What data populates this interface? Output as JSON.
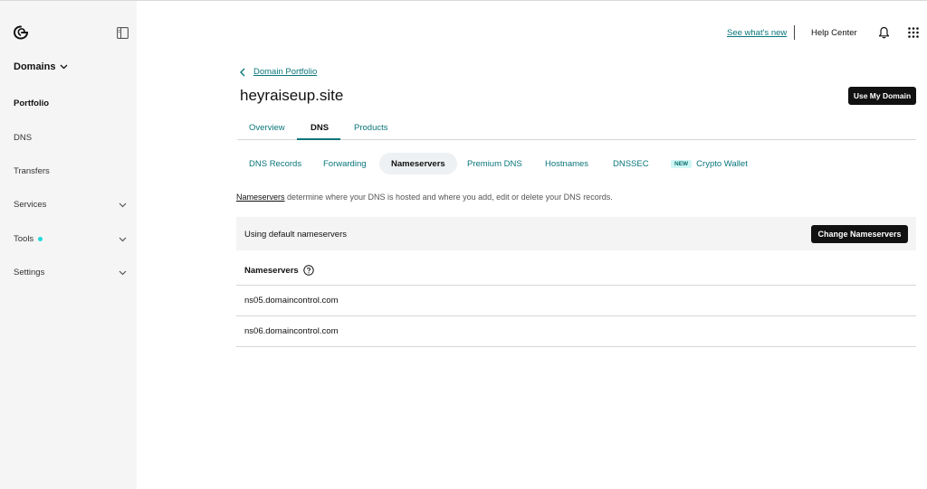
{
  "sidebar": {
    "logo_icon": "godaddy-logo-icon",
    "section_title": "Domains",
    "items": [
      {
        "label": "Portfolio",
        "active": true,
        "expandable": false,
        "dot": false
      },
      {
        "label": "DNS",
        "active": false,
        "expandable": false,
        "dot": false
      },
      {
        "label": "Transfers",
        "active": false,
        "expandable": false,
        "dot": false
      },
      {
        "label": "Services",
        "active": false,
        "expandable": true,
        "dot": false
      },
      {
        "label": "Tools",
        "active": false,
        "expandable": true,
        "dot": true
      },
      {
        "label": "Settings",
        "active": false,
        "expandable": true,
        "dot": false
      }
    ]
  },
  "topbar": {
    "see_whats_new": "See what's new",
    "help_center": "Help Center",
    "bell_icon": "bell-icon",
    "apps_icon": "apps-grid-icon"
  },
  "breadcrumb": {
    "label": "Domain Portfolio"
  },
  "domain": {
    "name": "heyraiseup.site"
  },
  "use_domain_button": "Use My Domain",
  "tabs": [
    {
      "label": "Overview",
      "active": false
    },
    {
      "label": "DNS",
      "active": true
    },
    {
      "label": "Products",
      "active": false
    }
  ],
  "subtabs": [
    {
      "label": "DNS Records",
      "active": false
    },
    {
      "label": "Forwarding",
      "active": false
    },
    {
      "label": "Nameservers",
      "active": true
    },
    {
      "label": "Premium DNS",
      "active": false
    },
    {
      "label": "Hostnames",
      "active": false
    },
    {
      "label": "DNSSEC",
      "active": false
    },
    {
      "label": "Crypto Wallet",
      "active": false,
      "badge": "NEW"
    }
  ],
  "description": {
    "link": "Nameservers",
    "text": " determine where your DNS is hosted and where you add, edit or delete your DNS records."
  },
  "banner": {
    "text": "Using default nameservers",
    "button": "Change Nameservers"
  },
  "nameservers": {
    "header": "Nameservers",
    "rows": [
      "ns05.domaincontrol.com",
      "ns06.domaincontrol.com"
    ]
  },
  "colors": {
    "accent_teal": "#09757a",
    "button_dark": "#111111",
    "sidebar_bg": "#f5f5f5",
    "dot_cyan": "#1bdbdb"
  }
}
